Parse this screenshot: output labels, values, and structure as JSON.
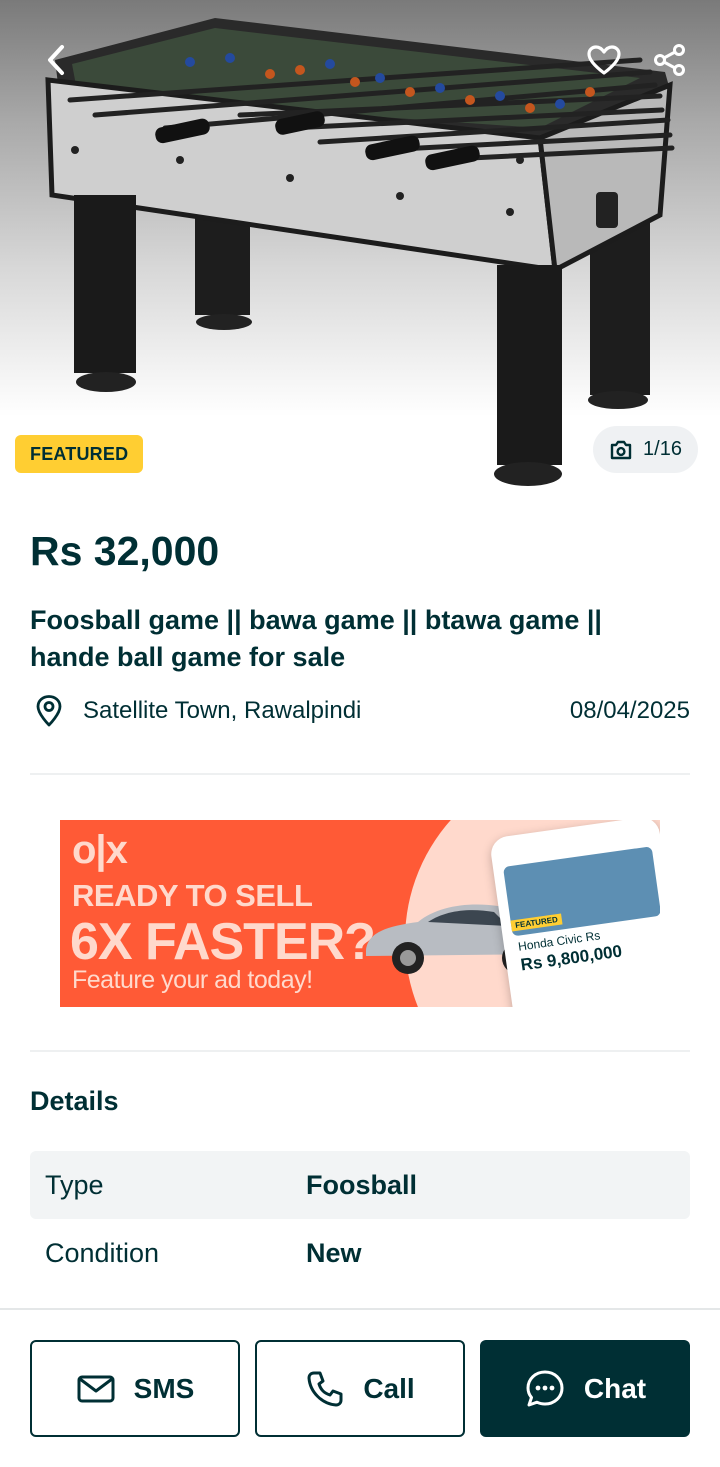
{
  "colors": {
    "brand_dark": "#002f34",
    "featured_yellow": "#ffce32",
    "banner_orange": "#ff5a36"
  },
  "hero": {
    "featured_label": "FEATURED",
    "photo_counter": "1/16",
    "icons": [
      "chevron-left-icon",
      "heart-icon",
      "share-icon",
      "camera-icon"
    ]
  },
  "listing": {
    "price": "Rs 32,000",
    "title": "Foosball game || bawa game || btawa game || hande ball game for sale",
    "location": "Satellite Town, Rawalpindi",
    "date": "08/04/2025"
  },
  "banner": {
    "logo": "o|x",
    "line1": "READY TO SELL",
    "line2": "6X FASTER?",
    "line3": "Feature your ad today!",
    "phone_tag": "FEATURED",
    "phone_car": "Honda Civic Rs",
    "phone_price": "Rs 9,800,000"
  },
  "details": {
    "heading": "Details",
    "rows": [
      {
        "key": "Type",
        "value": "Foosball"
      },
      {
        "key": "Condition",
        "value": "New"
      }
    ]
  },
  "actions": {
    "sms_label": "SMS",
    "call_label": "Call",
    "chat_label": "Chat"
  }
}
